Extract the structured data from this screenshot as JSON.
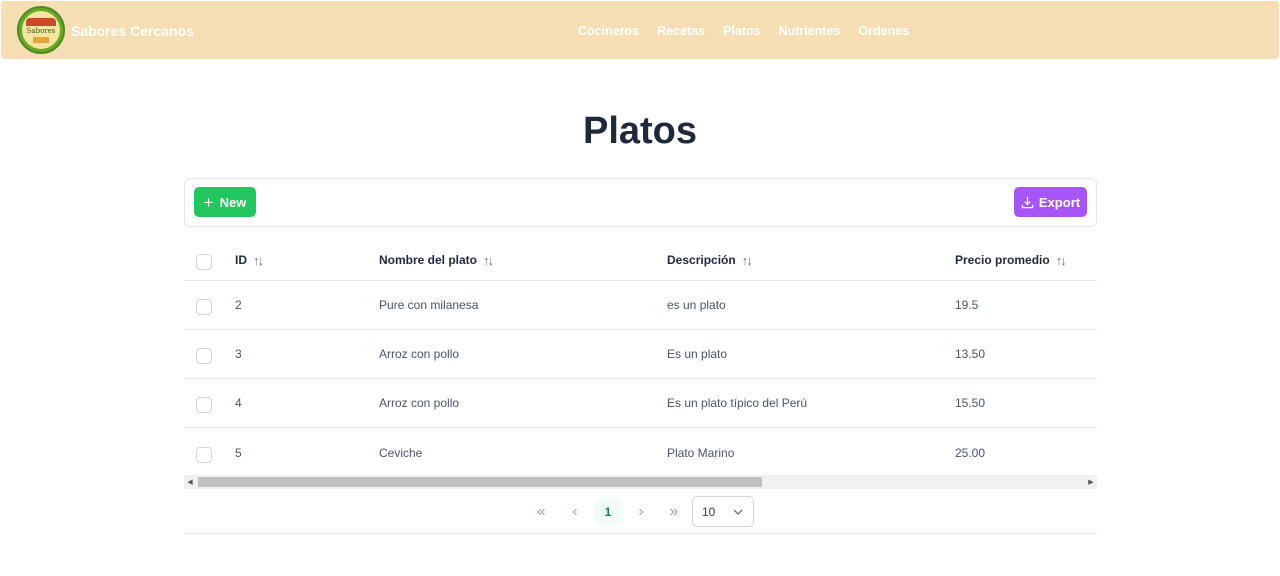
{
  "navbar": {
    "brand": "Sabores Cercanos",
    "logo_text": "Sabores",
    "links": [
      "Cocineros",
      "Recetas",
      "Platos",
      "Nutrientes",
      "Ordenes"
    ],
    "background": "#f5deb3"
  },
  "page": {
    "title": "Platos"
  },
  "toolbar": {
    "new_label": "New",
    "export_label": "Export",
    "new_color": "#22c55e",
    "export_color": "#a855f7"
  },
  "table": {
    "columns": [
      "ID",
      "Nombre del plato",
      "Descripción",
      "Precio promedio"
    ],
    "rows": [
      {
        "id": "2",
        "name": "Pure con milanesa",
        "desc": "es un plato",
        "price": "19.5"
      },
      {
        "id": "3",
        "name": "Arroz con pollo",
        "desc": "Es un plato",
        "price": "13.50"
      },
      {
        "id": "4",
        "name": "Arroz con pollo",
        "desc": "Es un plato típico del Perú",
        "price": "15.50"
      },
      {
        "id": "5",
        "name": "Ceviche",
        "desc": "Plato Marino",
        "price": "25.00"
      }
    ]
  },
  "paginator": {
    "first": "«",
    "prev": "‹",
    "current_page": "1",
    "next": "›",
    "last": "»",
    "rows_per_page": "10"
  }
}
